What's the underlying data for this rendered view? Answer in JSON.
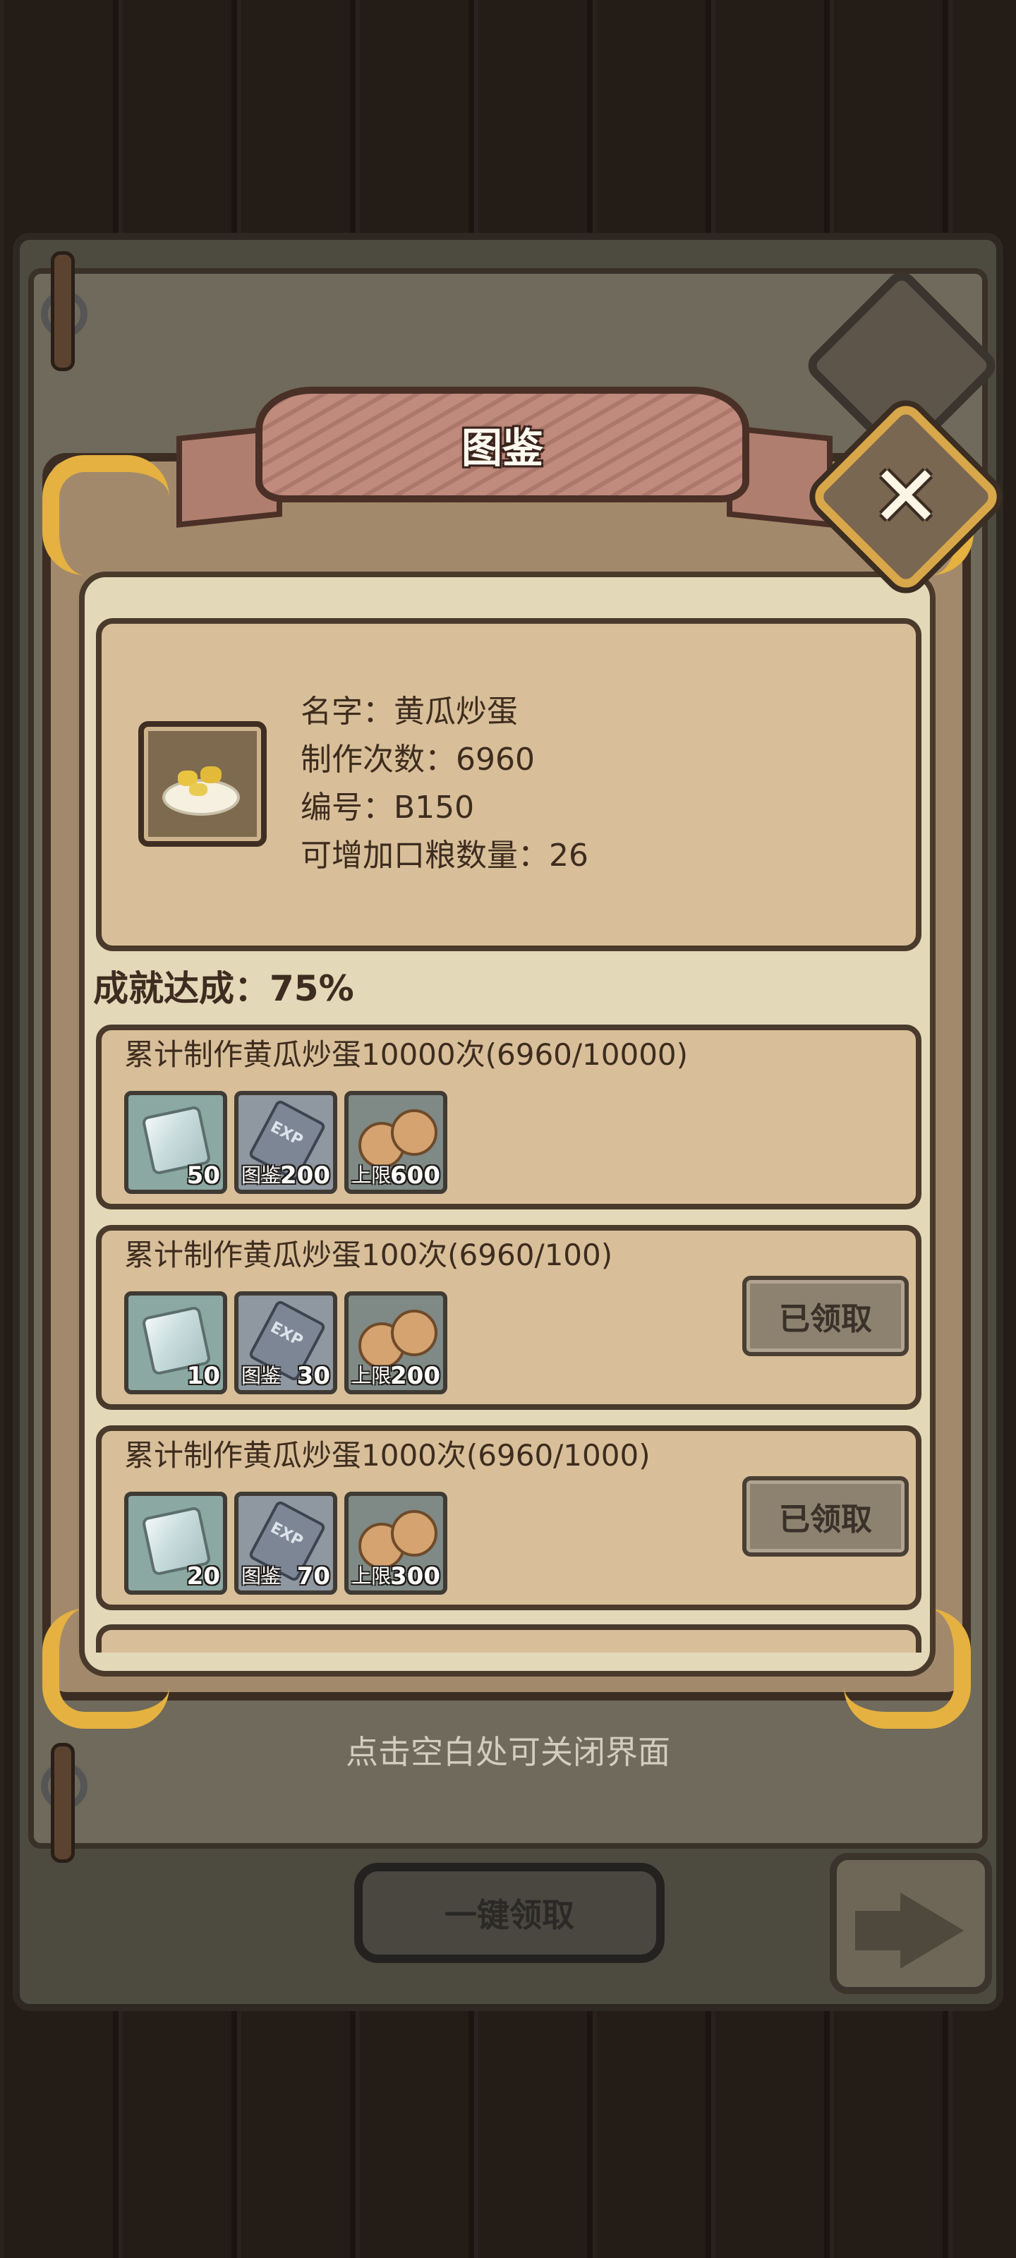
{
  "dialog": {
    "title": "图鉴",
    "close_icon": "close-icon"
  },
  "info": {
    "name": "名字：黄瓜炒蛋",
    "times": "制作次数：6960",
    "number": "编号：B150",
    "food_capacity": "可增加口粮数量：26"
  },
  "achievement": {
    "label": "成就达成：75%",
    "rows": [
      {
        "title": "累计制作黄瓜炒蛋10000次(6960/10000)",
        "rewards": [
          {
            "icon": "gem-icon",
            "qty": "50"
          },
          {
            "icon": "exp-book-icon",
            "tag": "图鉴",
            "qty": "200"
          },
          {
            "icon": "cookie-icon",
            "tag": "上限",
            "qty": "600"
          }
        ]
      },
      {
        "title": "累计制作黄瓜炒蛋100次(6960/100)",
        "rewards": [
          {
            "icon": "gem-icon",
            "qty": "10"
          },
          {
            "icon": "exp-book-icon",
            "tag": "图鉴",
            "qty": "30"
          },
          {
            "icon": "cookie-icon",
            "tag": "上限",
            "qty": "200"
          }
        ],
        "status": "已领取"
      },
      {
        "title": "累计制作黄瓜炒蛋1000次(6960/1000)",
        "rewards": [
          {
            "icon": "gem-icon",
            "qty": "20"
          },
          {
            "icon": "exp-book-icon",
            "tag": "图鉴",
            "qty": "70"
          },
          {
            "icon": "cookie-icon",
            "tag": "上限",
            "qty": "300"
          }
        ],
        "status": "已领取"
      }
    ]
  },
  "exp_label": "EXP",
  "hint": "点击空白处可关闭界面",
  "bottom": {
    "one_click_label": "一键领取"
  },
  "colors": {
    "gold_trim": "#e5b140",
    "ribbon": "#c08a7d",
    "card": "#d8bf99",
    "panel": "#e3d8b8"
  }
}
